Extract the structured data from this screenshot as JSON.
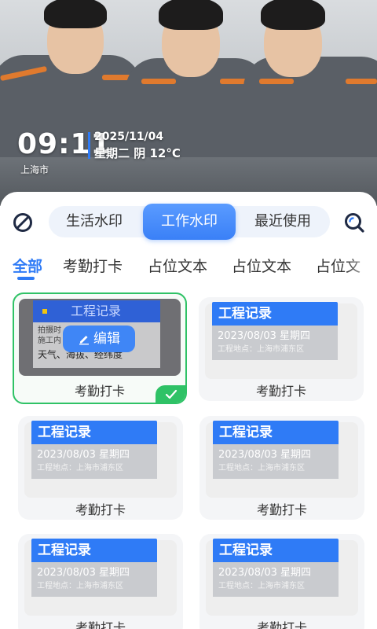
{
  "header": {
    "watermark": {
      "time": "09:11",
      "date": "2025/11/04",
      "weather": "星期二 阴 12°C",
      "city": "上海市"
    },
    "accent_color": "#2f7bf6"
  },
  "toolbar": {
    "left_icon": "slash-circle-icon",
    "right_icon": "search-icon",
    "modes": [
      {
        "label": "生活水印",
        "active": false
      },
      {
        "label": "工作水印",
        "active": true
      },
      {
        "label": "最近使用",
        "active": false
      }
    ]
  },
  "categories": [
    {
      "label": "全部",
      "active": true
    },
    {
      "label": "考勤打卡",
      "active": false
    },
    {
      "label": "占位文本",
      "active": false
    },
    {
      "label": "占位文本",
      "active": false
    },
    {
      "label": "占位文",
      "active": false
    }
  ],
  "selected_card": {
    "title": "工程记录",
    "line1": "拍摄时",
    "line2": "施工内",
    "line3": "天气、海拔、经纬度",
    "edit_label": "编辑",
    "label": "考勤打卡",
    "selected_color": "#2fc266"
  },
  "cards": [
    {
      "title": "工程记录",
      "date": "2023/08/03 星期四",
      "location": "工程地点：上海市浦东区",
      "label": "考勤打卡"
    },
    {
      "title": "工程记录",
      "date": "2023/08/03 星期四",
      "location": "工程地点：上海市浦东区",
      "label": "考勤打卡"
    },
    {
      "title": "工程记录",
      "date": "2023/08/03 星期四",
      "location": "工程地点：上海市浦东区",
      "label": "考勤打卡"
    },
    {
      "title": "工程记录",
      "date": "2023/08/03 星期四",
      "location": "工程地点：上海市浦东区",
      "label": "考勤打卡"
    },
    {
      "title": "工程记录",
      "date": "2023/08/03 星期四",
      "location": "工程地点：上海市浦东区",
      "label": "考勤打卡"
    }
  ]
}
